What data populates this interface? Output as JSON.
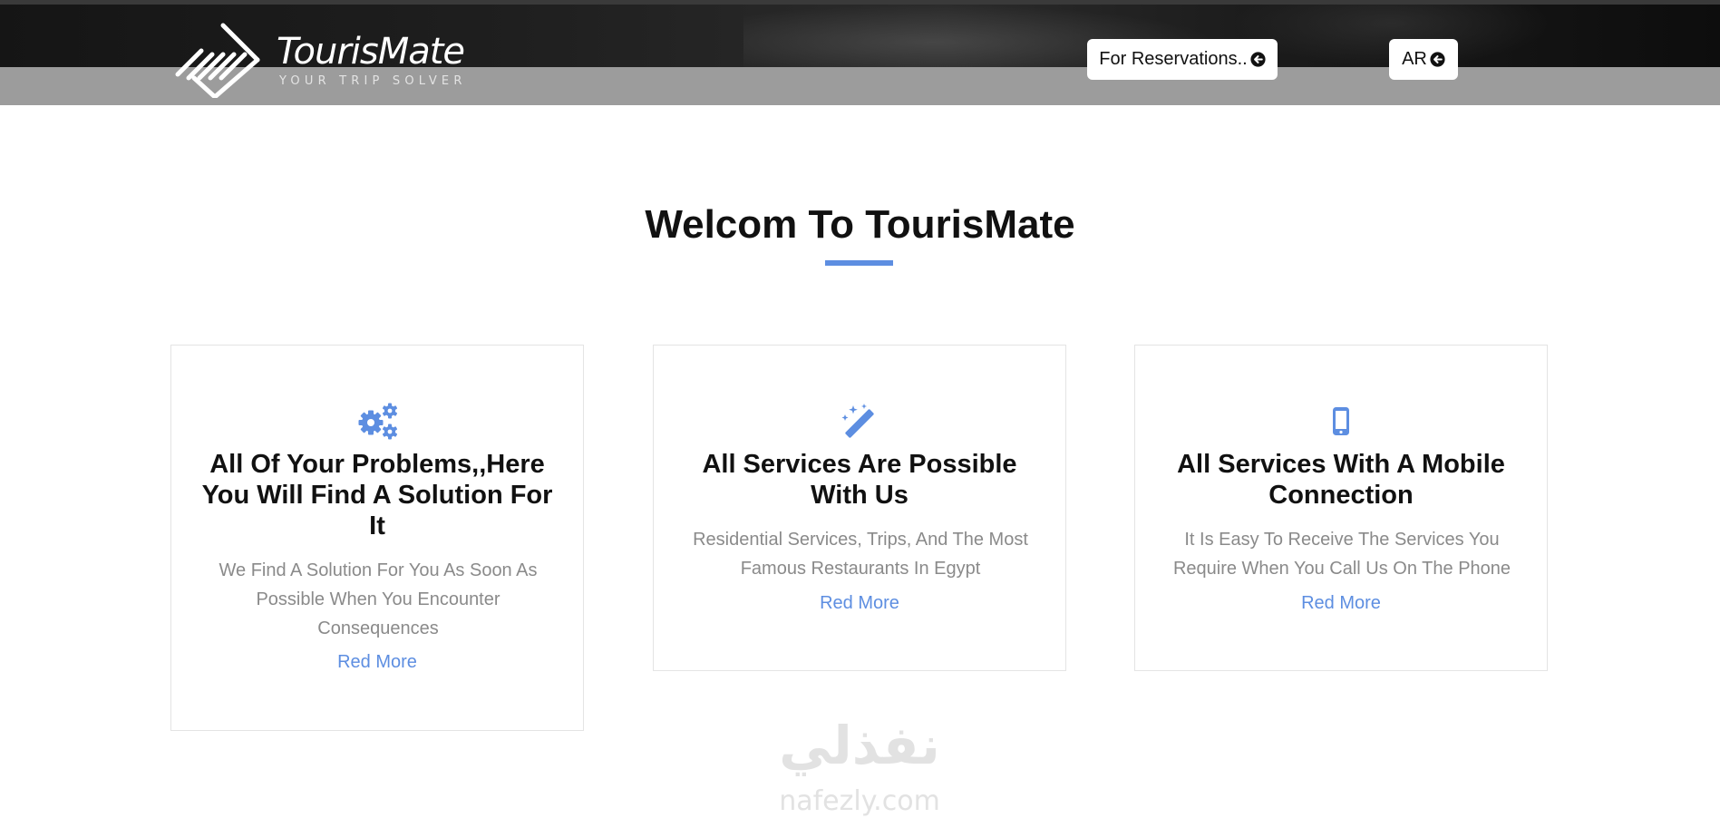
{
  "header": {
    "logo": {
      "name": "TourisMate",
      "tagline": "YOUR TRIP SOLVER",
      "mark_icon": "diagonal-stripes-arrow-icon"
    },
    "reservations_label": "For Reservations..",
    "language_label": "AR",
    "button_icon": "arrow-left-circle-icon"
  },
  "main": {
    "title": "Welcom To TourisMate",
    "cards": [
      {
        "icon": "gears-icon",
        "title": "All Of Your Problems,,Here You Will Find A Solution For It",
        "description": "We Find A Solution For You As Soon As Possible When You Encounter Consequences",
        "link": "Red More"
      },
      {
        "icon": "magic-wand-icon",
        "title": "All Services Are Possible With Us",
        "description": "Residential Services, Trips, And The Most Famous Restaurants In Egypt",
        "link": "Red More"
      },
      {
        "icon": "mobile-phone-icon",
        "title": "All Services With A Mobile Connection",
        "description": "It Is Easy To Receive The Services You Require When You Call Us On The Phone",
        "link": "Red More"
      }
    ]
  },
  "watermark": {
    "arabic": "نفذلي",
    "latin": "nafezly.com"
  },
  "colors": {
    "accent": "#5d8ee1",
    "header_band": "#9c9c9c",
    "description_text": "#8a8a8a"
  }
}
